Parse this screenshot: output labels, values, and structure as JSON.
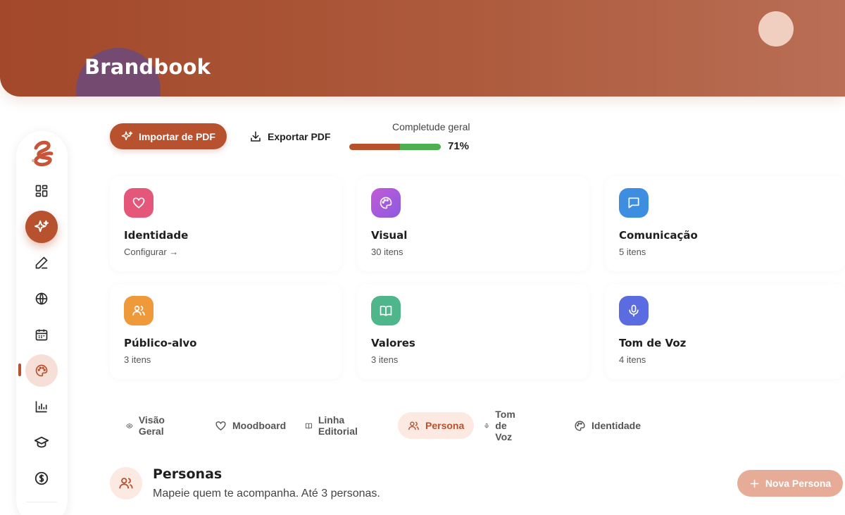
{
  "header": {
    "title": "Brandbook",
    "colors": {
      "accent": "#b8512e",
      "banner": "#a3482a"
    }
  },
  "sidebar": {
    "items": [
      {
        "name": "dashboard",
        "icon": "grid-icon",
        "state": "default"
      },
      {
        "name": "ai",
        "icon": "sparkles-icon",
        "state": "active"
      },
      {
        "name": "edit",
        "icon": "pencil-icon",
        "state": "default"
      },
      {
        "name": "web",
        "icon": "globe-icon",
        "state": "default"
      },
      {
        "name": "calendar",
        "icon": "calendar-icon",
        "state": "default"
      },
      {
        "name": "brandbook",
        "icon": "palette-icon",
        "state": "selected"
      },
      {
        "name": "analytics",
        "icon": "bar-chart-icon",
        "state": "default"
      },
      {
        "name": "learning",
        "icon": "graduation-cap-icon",
        "state": "default"
      },
      {
        "name": "finance",
        "icon": "dollar-icon",
        "state": "default"
      }
    ]
  },
  "toolbar": {
    "import_label": "Importar de PDF",
    "export_label": "Exportar PDF",
    "completeness_label": "Completude geral",
    "completeness_value": "71%",
    "completeness_fraction": 0.71
  },
  "cards": [
    {
      "title": "Identidade",
      "subtitle": "Configurar →",
      "icon": "heart-icon",
      "color": "#e5577a"
    },
    {
      "title": "Visual",
      "subtitle": "30 itens",
      "icon": "palette-icon",
      "color": "#a35bd6"
    },
    {
      "title": "Comunicação",
      "subtitle": "5 itens",
      "icon": "message-icon",
      "color": "#3d8ee0"
    },
    {
      "title": "Público-alvo",
      "subtitle": "3 itens",
      "icon": "users-icon",
      "color": "#ee9a3a"
    },
    {
      "title": "Valores",
      "subtitle": "3 itens",
      "icon": "book-icon",
      "color": "#4fb58a"
    },
    {
      "title": "Tom de Voz",
      "subtitle": "4 itens",
      "icon": "mic-icon",
      "color": "#5b6be0"
    }
  ],
  "tabs": [
    {
      "label": "Visão Geral",
      "icon": "eye-icon",
      "active": false
    },
    {
      "label": "Moodboard",
      "icon": "heart-icon",
      "active": false
    },
    {
      "label": "Linha Editorial",
      "icon": "book-icon",
      "active": false
    },
    {
      "label": "Persona",
      "icon": "users-icon",
      "active": true
    },
    {
      "label": "Tom de Voz",
      "icon": "mic-icon",
      "active": false
    },
    {
      "label": "Identidade",
      "icon": "palette-icon",
      "active": false
    }
  ],
  "persona": {
    "title": "Personas",
    "subtitle": "Mapeie quem te acompanha. Até 3 personas.",
    "new_label": "Nova Persona"
  }
}
